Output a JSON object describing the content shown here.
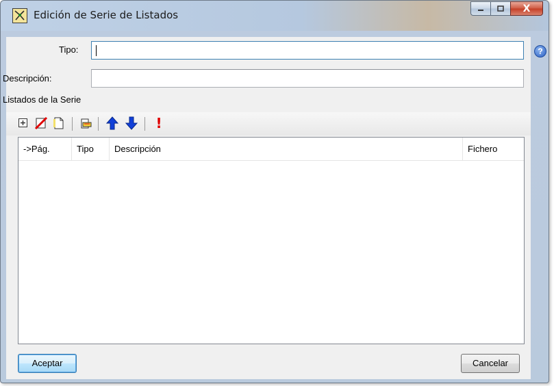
{
  "window": {
    "title": "Edición de Serie de Listados",
    "close_glyph": "X"
  },
  "form": {
    "tipo_label": "Tipo:",
    "tipo_value": "",
    "descripcion_label": "Descripción:",
    "descripcion_value": "",
    "help_glyph": "?"
  },
  "section": {
    "title": "Listados de la Serie"
  },
  "toolbar": {
    "icons": [
      "add-icon",
      "delete-icon",
      "copy-icon",
      "open-icon",
      "move-up-icon",
      "move-down-icon",
      "error-icon"
    ],
    "alert_glyph": "!"
  },
  "table": {
    "columns": [
      "->Pág.",
      "Tipo",
      "Descripción",
      "Fichero"
    ],
    "rows": []
  },
  "buttons": {
    "ok": "Aceptar",
    "cancel": "Cancelar"
  },
  "colors": {
    "arrow_blue": "#1140d8",
    "alert_red": "#e00000"
  }
}
